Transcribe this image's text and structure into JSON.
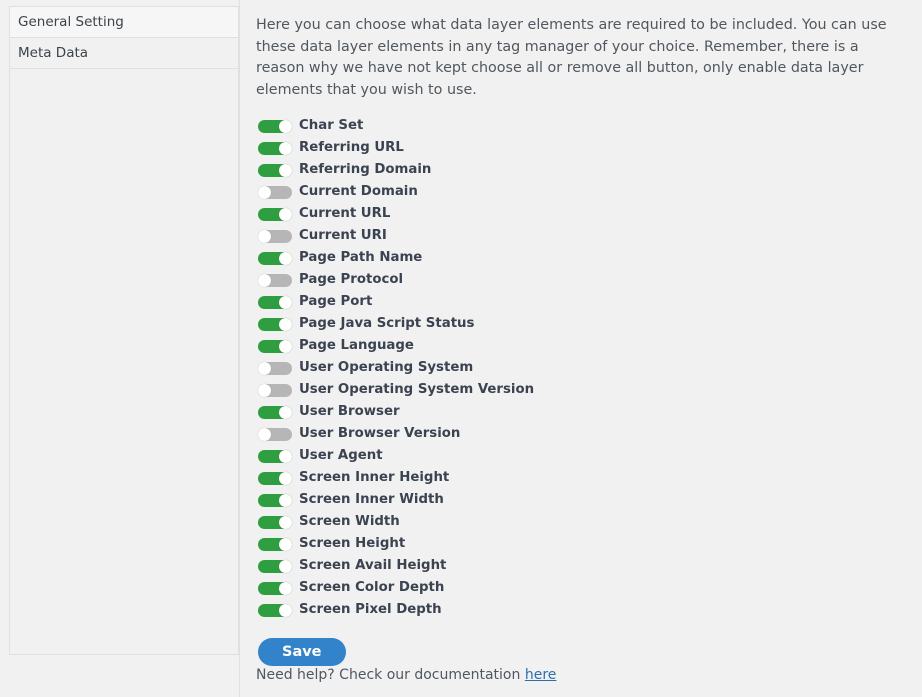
{
  "sidebar": {
    "items": [
      {
        "label": "General Setting",
        "active": true
      },
      {
        "label": "Meta Data",
        "active": false
      }
    ]
  },
  "main": {
    "intro": "Here you can choose what data layer elements are required to be included. You can use these data layer elements in any tag manager of your choice. Remember, there is a reason why we have not kept choose all or remove all button, only enable data layer elements that you wish to use.",
    "save_label": "Save",
    "toggles": [
      {
        "label": "Char Set",
        "on": true
      },
      {
        "label": "Referring URL",
        "on": true
      },
      {
        "label": "Referring Domain",
        "on": true
      },
      {
        "label": "Current Domain",
        "on": false
      },
      {
        "label": "Current URL",
        "on": true
      },
      {
        "label": "Current URI",
        "on": false
      },
      {
        "label": "Page Path Name",
        "on": true
      },
      {
        "label": "Page Protocol",
        "on": false
      },
      {
        "label": "Page Port",
        "on": true
      },
      {
        "label": "Page Java Script Status",
        "on": true
      },
      {
        "label": "Page Language",
        "on": true
      },
      {
        "label": "User Operating System",
        "on": false
      },
      {
        "label": "User Operating System Version",
        "on": false
      },
      {
        "label": "User Browser",
        "on": true
      },
      {
        "label": "User Browser Version",
        "on": false
      },
      {
        "label": "User Agent",
        "on": true
      },
      {
        "label": "Screen Inner Height",
        "on": true
      },
      {
        "label": "Screen Inner Width",
        "on": true
      },
      {
        "label": "Screen Width",
        "on": true
      },
      {
        "label": "Screen Height",
        "on": true
      },
      {
        "label": "Screen Avail Height",
        "on": true
      },
      {
        "label": "Screen Color Depth",
        "on": true
      },
      {
        "label": "Screen Pixel Depth",
        "on": true
      }
    ]
  },
  "footer": {
    "help_text": "Need help? Check our documentation",
    "help_link_label": "here"
  },
  "colors": {
    "toggle_on": "#2f9e41",
    "toggle_off": "#b6b6b6",
    "save_button": "#3283c9",
    "link": "#2c6faf",
    "page_background": "#f1f1f1",
    "label_text": "#3b4351"
  }
}
